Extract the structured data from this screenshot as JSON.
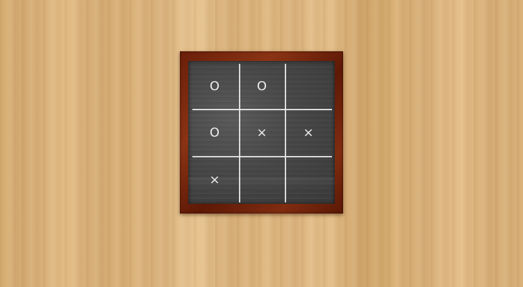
{
  "game": {
    "board": [
      [
        "O",
        "O",
        ""
      ],
      [
        "O",
        "×",
        "×"
      ],
      [
        "×",
        "",
        ""
      ]
    ]
  }
}
